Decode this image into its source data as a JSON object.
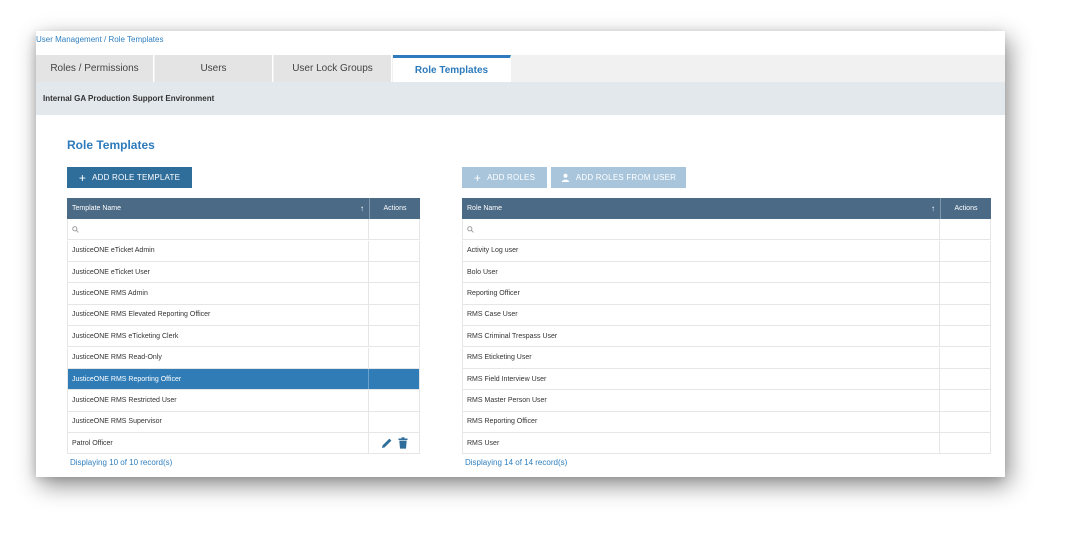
{
  "breadcrumb": "User Management / Role Templates",
  "tabs": [
    {
      "label": "Roles / Permissions",
      "active": false
    },
    {
      "label": "Users",
      "active": false
    },
    {
      "label": "User Lock Groups",
      "active": false
    },
    {
      "label": "Role Templates",
      "active": true
    }
  ],
  "environment": "Internal GA Production Support Environment",
  "section_title": "Role Templates",
  "buttons": {
    "add_template": "ADD ROLE TEMPLATE",
    "add_roles": "ADD ROLES",
    "add_roles_from_user": "ADD ROLES FROM USER"
  },
  "templates_grid": {
    "col_name": "Template Name",
    "col_actions": "Actions",
    "rows": [
      "JusticeONE eTicket Admin",
      "JusticeONE eTicket User",
      "JusticeONE RMS Admin",
      "JusticeONE RMS Elevated Reporting Officer",
      "JusticeONE RMS eTicketing Clerk",
      "JusticeONE RMS Read-Only",
      "JusticeONE RMS Reporting Officer",
      "JusticeONE RMS Restricted User",
      "JusticeONE RMS Supervisor",
      "Patrol Officer"
    ],
    "selected_index": 6,
    "footer": "Displaying 10 of 10 record(s)"
  },
  "roles_grid": {
    "col_name": "Role Name",
    "col_actions": "Actions",
    "rows": [
      "Activity Log user",
      "Bolo User",
      "Reporting Officer",
      "RMS Case User",
      "RMS Criminal Trespass User",
      "RMS Eticketing User",
      "RMS Field Interview User",
      "RMS Master Person User",
      "RMS Reporting Officer",
      "RMS User"
    ],
    "footer": "Displaying 14 of 14 record(s)"
  },
  "icons": {
    "add": "plus-icon",
    "user": "user-icon",
    "sort": "arrow-up-icon",
    "search": "search-icon",
    "edit": "pencil-icon",
    "delete": "trash-icon"
  },
  "colors": {
    "accent": "#2d7bbc",
    "header": "#4a6a86",
    "selected": "#2f7cb7",
    "button": "#2f6d9b",
    "button_disabled": "#a8c5dc"
  }
}
